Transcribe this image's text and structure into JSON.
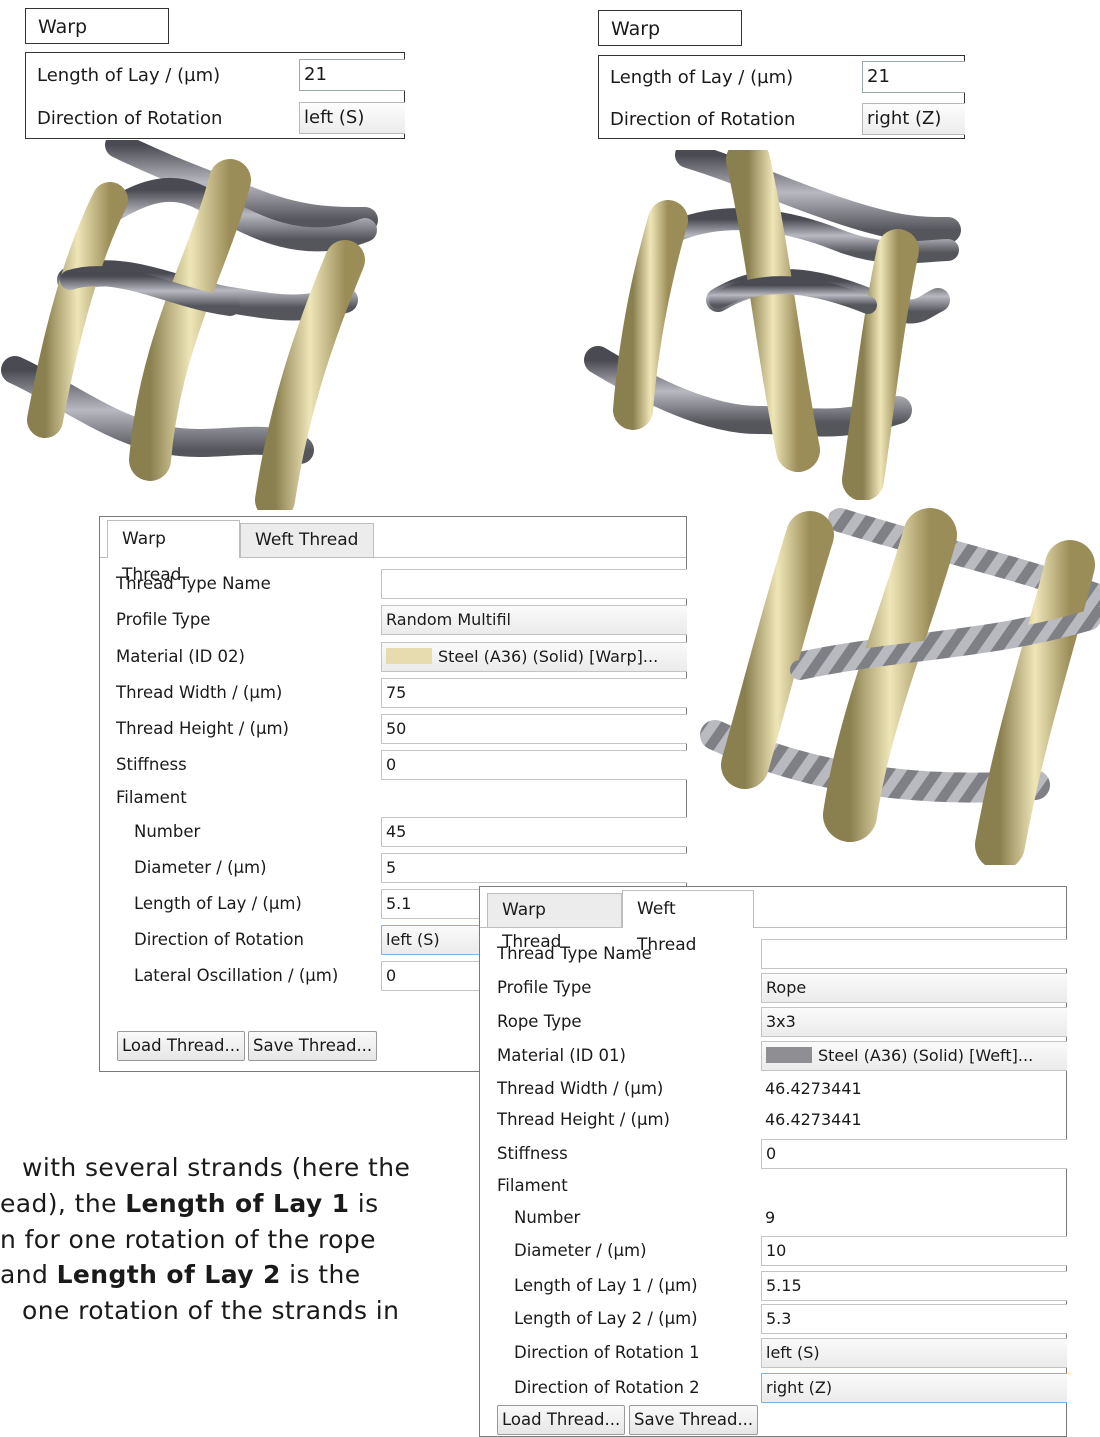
{
  "left_top_panel": {
    "tab_label": "Warp Thread",
    "rows": [
      {
        "label": "Length of Lay / (µm)",
        "value": "21"
      },
      {
        "label": "Direction of Rotation",
        "value": "left (S)"
      }
    ]
  },
  "right_top_panel": {
    "tab_label": "Warp Thread",
    "rows": [
      {
        "label": "Length of Lay / (µm)",
        "value": "21"
      },
      {
        "label": "Direction of Rotation",
        "value": "right (Z)"
      }
    ]
  },
  "warp_dialog": {
    "tabs": [
      "Warp Thread",
      "Weft Thread"
    ],
    "active_tab": "Warp Thread",
    "properties": {
      "thread_type_name": {
        "label": "Thread Type Name",
        "value": ""
      },
      "profile_type": {
        "label": "Profile Type",
        "value": "Random Multifil"
      },
      "material": {
        "label": "Material (ID 02)",
        "value": "Steel (A36) (Solid) [Warp]...",
        "swatch_color": "#e6dcb0"
      },
      "thread_width": {
        "label": "Thread Width / (µm)",
        "value": "75"
      },
      "thread_height": {
        "label": "Thread Height / (µm)",
        "value": "50"
      },
      "stiffness": {
        "label": "Stiffness",
        "value": "0"
      },
      "filament": {
        "label": "Filament"
      },
      "number": {
        "label": "Number",
        "value": "45"
      },
      "diameter": {
        "label": "Diameter / (µm)",
        "value": "5"
      },
      "length_of_lay": {
        "label": "Length of Lay / (µm)",
        "value": "5.1"
      },
      "direction": {
        "label": "Direction of Rotation",
        "value": "left (S)"
      },
      "lateral": {
        "label": "Lateral Oscillation / (µm)",
        "value": "0"
      }
    },
    "load_label": "Load Thread...",
    "save_label": "Save Thread..."
  },
  "weft_dialog": {
    "tabs": [
      "Warp Thread",
      "Weft Thread"
    ],
    "active_tab": "Weft Thread",
    "properties": {
      "thread_type_name": {
        "label": "Thread Type Name",
        "value": ""
      },
      "profile_type": {
        "label": "Profile Type",
        "value": "Rope"
      },
      "rope_type": {
        "label": "Rope Type",
        "value": "3x3"
      },
      "material": {
        "label": "Material (ID 01)",
        "value": "Steel (A36) (Solid) [Weft]...",
        "swatch_color": "#8f8f93"
      },
      "thread_width": {
        "label": "Thread Width / (µm)",
        "value": "46.4273441"
      },
      "thread_height": {
        "label": "Thread Height / (µm)",
        "value": "46.4273441"
      },
      "stiffness": {
        "label": "Stiffness",
        "value": "0"
      },
      "filament": {
        "label": "Filament"
      },
      "number": {
        "label": "Number",
        "value": "9"
      },
      "diameter": {
        "label": "Diameter / (µm)",
        "value": "10"
      },
      "lay1": {
        "label": "Length of Lay 1 / (µm)",
        "value": "5.15"
      },
      "lay2": {
        "label": "Length of Lay 2 / (µm)",
        "value": "5.3"
      },
      "dir1": {
        "label": "Direction of Rotation 1",
        "value": "left (S)"
      },
      "dir2": {
        "label": "Direction of Rotation 2",
        "value": "right (Z)"
      }
    },
    "load_label": "Load Thread...",
    "save_label": "Save Thread..."
  },
  "paragraph": {
    "line1": "with several strands (here the",
    "line2a": "ead), the ",
    "line2b": "Length of Lay 1",
    "line2c": " is",
    "line3": "n for one rotation of the rope",
    "line4a": "and ",
    "line4b": "Length of Lay 2",
    "line4c": " is the",
    "line5": "one rotation of the strands in"
  },
  "colors": {
    "warp_thread": "#d9cf9a",
    "weft_thread": "#7d7d84",
    "focus_border": "#7eb4ea"
  }
}
